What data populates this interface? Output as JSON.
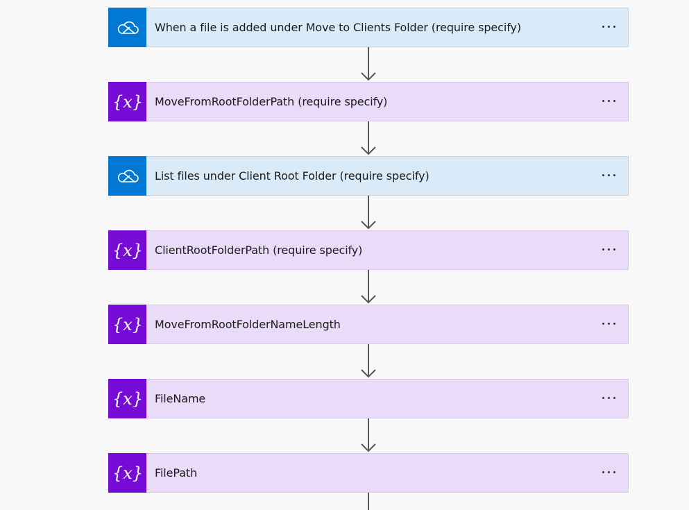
{
  "steps": [
    {
      "label": "When a file is added under Move to Clients Folder (require specify)",
      "kind": "onedrive",
      "icon": "onedrive-cloud-icon"
    },
    {
      "label": "MoveFromRootFolderPath (require specify)",
      "kind": "variable",
      "icon": "variable-icon"
    },
    {
      "label": "List files under Client Root Folder (require specify)",
      "kind": "onedrive",
      "icon": "onedrive-cloud-icon"
    },
    {
      "label": "ClientRootFolderPath (require specify)",
      "kind": "variable",
      "icon": "variable-icon"
    },
    {
      "label": "MoveFromRootFolderNameLength",
      "kind": "variable",
      "icon": "variable-icon"
    },
    {
      "label": "FileName",
      "kind": "variable",
      "icon": "variable-icon"
    },
    {
      "label": "FilePath",
      "kind": "variable",
      "icon": "variable-icon"
    }
  ],
  "colors": {
    "onedrive_icon_bg": "#0078d4",
    "onedrive_card_bg": "#d9eaf8",
    "variable_icon_bg": "#770bd6",
    "variable_card_bg": "#eadbf8",
    "connector": "#555555"
  },
  "icons": {
    "step_menu": "more-options-icon",
    "connector": "arrow-down-icon"
  }
}
